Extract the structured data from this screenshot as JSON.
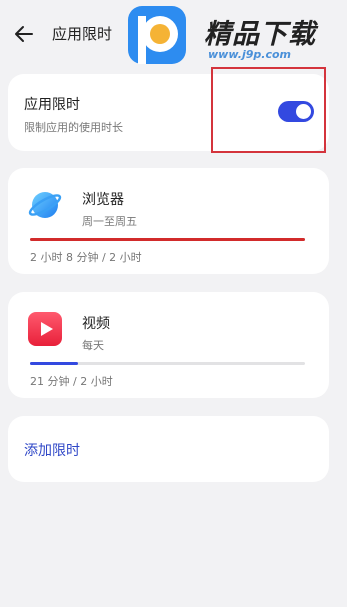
{
  "header": {
    "title": "应用限时",
    "back_icon": "arrow-left-icon"
  },
  "watermark": {
    "text": "精品下载",
    "url": "www.j9p.com"
  },
  "main_setting": {
    "title": "应用限时",
    "subtitle": "限制应用的使用时长",
    "enabled": true
  },
  "apps": [
    {
      "name": "浏览器",
      "schedule": "周一至周五",
      "usage": "2 小时 8 分钟 / 2 小时",
      "progress": 1.0,
      "progress_color": "#d22b2b",
      "icon": "browser-icon"
    },
    {
      "name": "视频",
      "schedule": "每天",
      "usage": "21 分钟 / 2 小时",
      "progress": 0.175,
      "progress_color": "#3349e0",
      "icon": "video-icon"
    }
  ],
  "add_label": "添加限时",
  "colors": {
    "accent": "#3349e0",
    "over_limit": "#d22b2b",
    "highlight_box": "#d4343c"
  }
}
